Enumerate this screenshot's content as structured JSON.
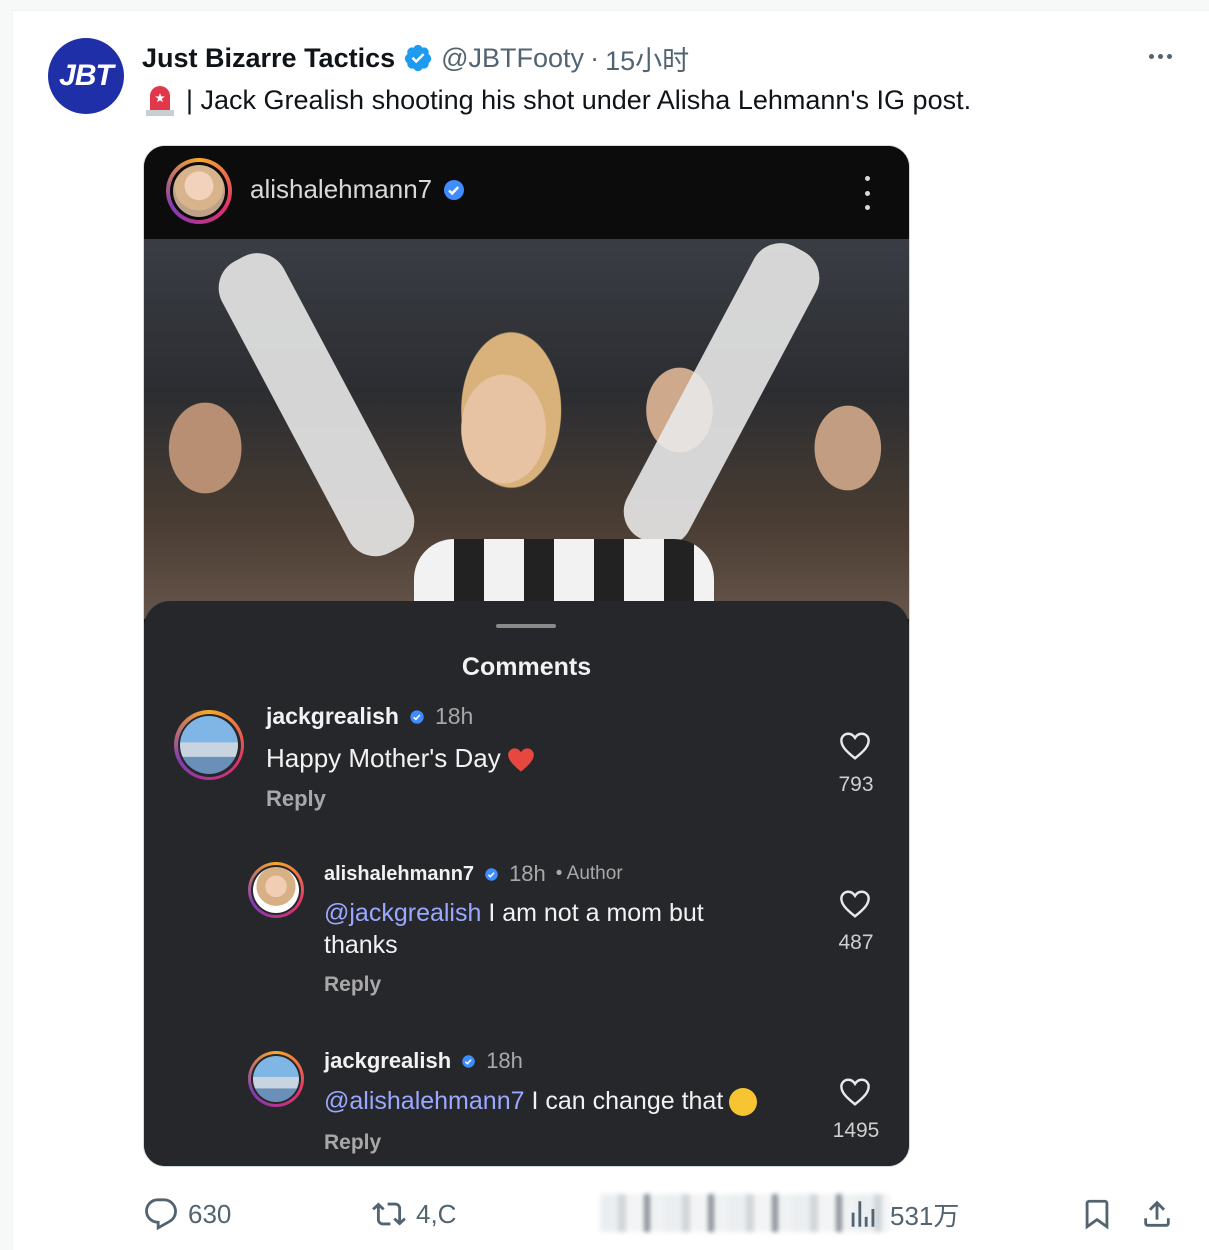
{
  "tweet": {
    "avatar_text": "JBT",
    "display_name": "Just Bizarre Tactics",
    "handle": "@JBTFooty",
    "separator": "·",
    "time": "15小时",
    "more_icon": "more-horizontal-icon",
    "text": "| Jack Grealish shooting his shot under Alisha Lehmann's IG post.",
    "leading_emoji": "siren-icon"
  },
  "instagram": {
    "username": "alishalehmann7",
    "comments_title": "Comments",
    "comments": [
      {
        "user": "jackgrealish",
        "time": "18h",
        "author_tag": "",
        "mention": "",
        "text": "Happy Mother's Day",
        "text_line2": "",
        "emoji": "red-heart",
        "reply_label": "Reply",
        "likes": "793"
      },
      {
        "user": "alishalehmann7",
        "time": "18h",
        "author_tag": "• Author",
        "mention": "@jackgrealish",
        "text": " I am not a mom but",
        "text_line2": "thanks",
        "emoji": "",
        "reply_label": "Reply",
        "likes": "487"
      },
      {
        "user": "jackgrealish",
        "time": "18h",
        "author_tag": "",
        "mention": "@alishalehmann7",
        "text": " I can change that",
        "text_line2": "",
        "emoji": "winking-face",
        "reply_label": "Reply",
        "likes": "1495"
      }
    ]
  },
  "actions": {
    "replies": "630",
    "retweets": "4,C",
    "views": "531万",
    "icons": [
      "reply-icon",
      "retweet-icon",
      "views-icon",
      "bookmark-icon",
      "share-icon"
    ]
  },
  "colors": {
    "verified_blue": "#1d9bf0",
    "ig_sheet": "#26272b",
    "mention": "#9aa8ff",
    "muted": "#536471"
  }
}
